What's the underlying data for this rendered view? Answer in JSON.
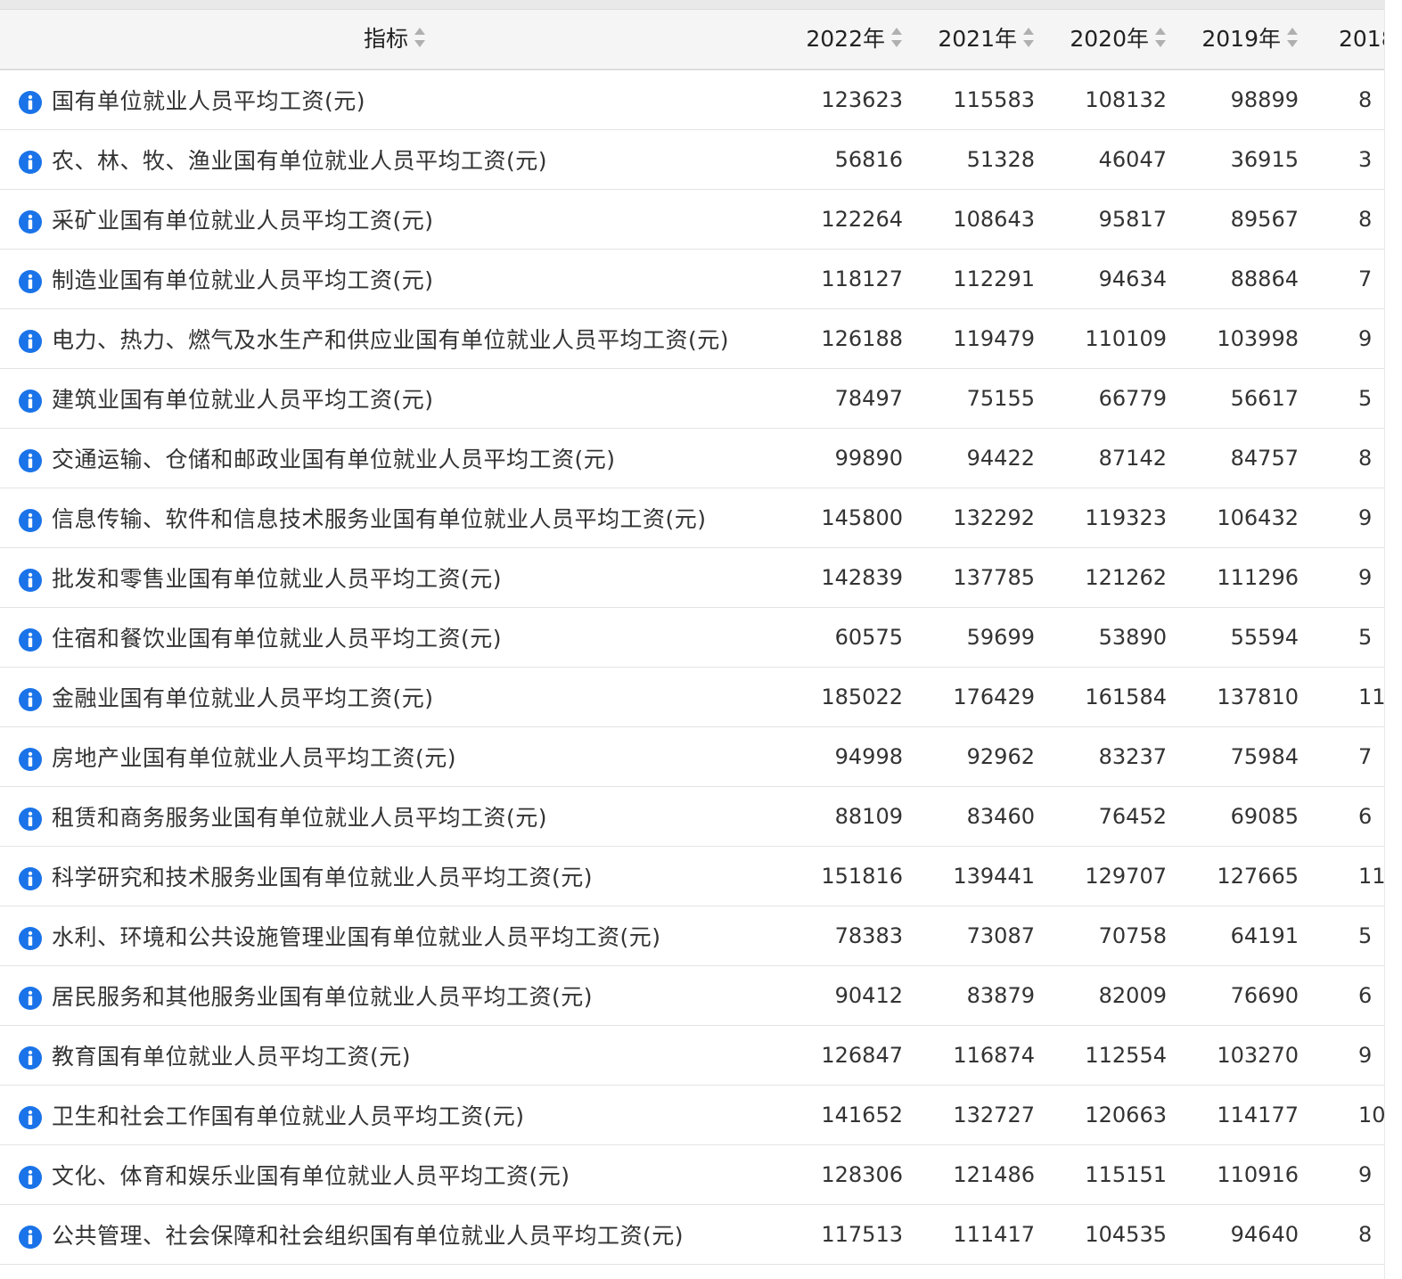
{
  "header": {
    "indicator": "指标",
    "years": [
      "2022年",
      "2021年",
      "2020年",
      "2019年",
      "2018"
    ]
  },
  "rows": [
    {
      "name": "国有单位就业人员平均工资(元)",
      "values": [
        "123623",
        "115583",
        "108132",
        "98899",
        "8"
      ]
    },
    {
      "name": "农、林、牧、渔业国有单位就业人员平均工资(元)",
      "values": [
        "56816",
        "51328",
        "46047",
        "36915",
        "3"
      ]
    },
    {
      "name": "采矿业国有单位就业人员平均工资(元)",
      "values": [
        "122264",
        "108643",
        "95817",
        "89567",
        "8"
      ]
    },
    {
      "name": "制造业国有单位就业人员平均工资(元)",
      "values": [
        "118127",
        "112291",
        "94634",
        "88864",
        "7"
      ]
    },
    {
      "name": "电力、热力、燃气及水生产和供应业国有单位就业人员平均工资(元)",
      "values": [
        "126188",
        "119479",
        "110109",
        "103998",
        "9"
      ]
    },
    {
      "name": "建筑业国有单位就业人员平均工资(元)",
      "values": [
        "78497",
        "75155",
        "66779",
        "56617",
        "5"
      ]
    },
    {
      "name": "交通运输、仓储和邮政业国有单位就业人员平均工资(元)",
      "values": [
        "99890",
        "94422",
        "87142",
        "84757",
        "8"
      ]
    },
    {
      "name": "信息传输、软件和信息技术服务业国有单位就业人员平均工资(元)",
      "values": [
        "145800",
        "132292",
        "119323",
        "106432",
        "9"
      ]
    },
    {
      "name": "批发和零售业国有单位就业人员平均工资(元)",
      "values": [
        "142839",
        "137785",
        "121262",
        "111296",
        "9"
      ]
    },
    {
      "name": "住宿和餐饮业国有单位就业人员平均工资(元)",
      "values": [
        "60575",
        "59699",
        "53890",
        "55594",
        "5"
      ]
    },
    {
      "name": "金融业国有单位就业人员平均工资(元)",
      "values": [
        "185022",
        "176429",
        "161584",
        "137810",
        "11"
      ]
    },
    {
      "name": "房地产业国有单位就业人员平均工资(元)",
      "values": [
        "94998",
        "92962",
        "83237",
        "75984",
        "7"
      ]
    },
    {
      "name": "租赁和商务服务业国有单位就业人员平均工资(元)",
      "values": [
        "88109",
        "83460",
        "76452",
        "69085",
        "6"
      ]
    },
    {
      "name": "科学研究和技术服务业国有单位就业人员平均工资(元)",
      "values": [
        "151816",
        "139441",
        "129707",
        "127665",
        "11"
      ]
    },
    {
      "name": "水利、环境和公共设施管理业国有单位就业人员平均工资(元)",
      "values": [
        "78383",
        "73087",
        "70758",
        "64191",
        "5"
      ]
    },
    {
      "name": "居民服务和其他服务业国有单位就业人员平均工资(元)",
      "values": [
        "90412",
        "83879",
        "82009",
        "76690",
        "6"
      ]
    },
    {
      "name": "教育国有单位就业人员平均工资(元)",
      "values": [
        "126847",
        "116874",
        "112554",
        "103270",
        "9"
      ]
    },
    {
      "name": "卫生和社会工作国有单位就业人员平均工资(元)",
      "values": [
        "141652",
        "132727",
        "120663",
        "114177",
        "10"
      ]
    },
    {
      "name": "文化、体育和娱乐业国有单位就业人员平均工资(元)",
      "values": [
        "128306",
        "121486",
        "115151",
        "110916",
        "9"
      ]
    },
    {
      "name": "公共管理、社会保障和社会组织国有单位就业人员平均工资(元)",
      "values": [
        "117513",
        "111417",
        "104535",
        "94640",
        "8"
      ]
    }
  ],
  "icons": {
    "info": "info-circle-icon",
    "sort": "sort-arrows-icon"
  },
  "colors": {
    "info_blue": "#1a73e8",
    "header_bg": "#f5f5f5",
    "sort_grey": "#b0b0b0"
  }
}
